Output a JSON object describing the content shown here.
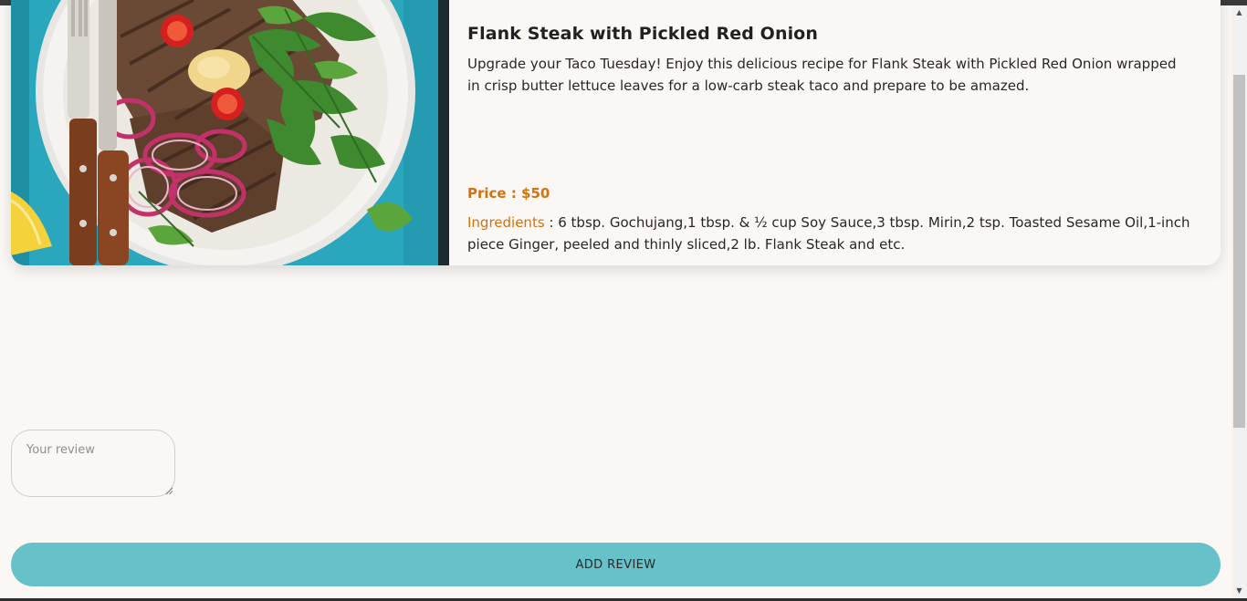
{
  "recipe": {
    "image_alt": "Grilled flank steak with pickled red onion, arugula and chili on a white plate",
    "title": "Flank Steak with Pickled Red Onion",
    "description": "Upgrade your Taco Tuesday! Enjoy this delicious recipe for Flank Steak with Pickled Red Onion wrapped in crisp butter lettuce leaves for a low-carb steak taco and prepare to be amazed.",
    "price": "Price : $50",
    "ingredients_label": "Ingredients",
    "ingredients_text": " : 6 tbsp. Gochujang,1 tbsp. & ½ cup Soy Sauce,3 tbsp. Mirin,2 tsp. Toasted Sesame Oil,1-inch piece Ginger, peeled and thinly sliced,2 lb. Flank Steak and etc."
  },
  "review": {
    "placeholder": "Your review",
    "value": ""
  },
  "actions": {
    "add_review_label": "ADD REVIEW"
  },
  "scrollbar": {
    "up_icon": "chevron-up-icon",
    "down_icon": "chevron-down-icon"
  },
  "colors": {
    "accent": "#d2720f",
    "button": "#66c2c8",
    "background": "#faf7f4"
  }
}
